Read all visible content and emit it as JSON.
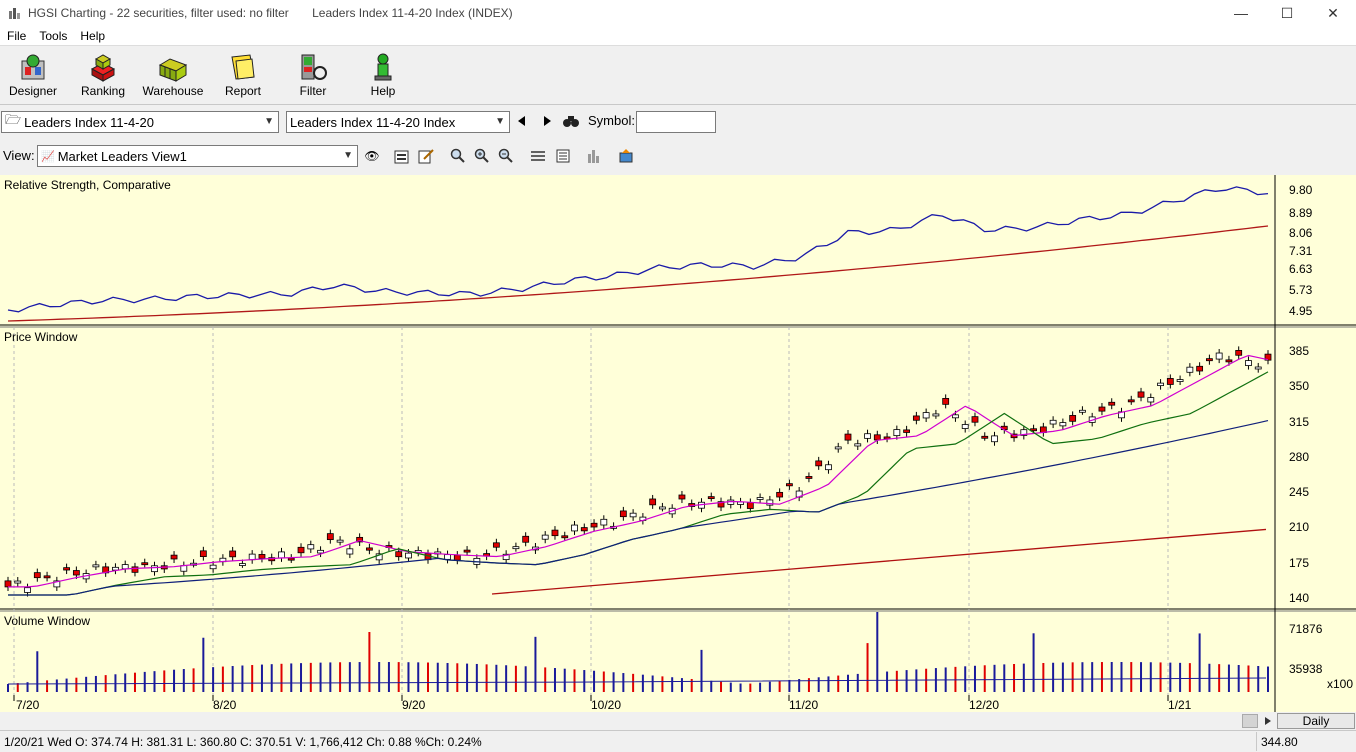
{
  "window": {
    "title": "HGSI Charting - 22 securities, filter used: no filter       Leaders Index 11-4-20 Index (INDEX)",
    "minimize": "—",
    "maximize": "☐",
    "close": "✕"
  },
  "menu": [
    "File",
    "Tools",
    "Help"
  ],
  "toolbar": {
    "buttons": [
      {
        "label": "Designer",
        "icon": "designer-icon"
      },
      {
        "label": "Ranking",
        "icon": "ranking-icon"
      },
      {
        "label": "Warehouse",
        "icon": "warehouse-icon"
      },
      {
        "label": "Report",
        "icon": "report-icon"
      },
      {
        "label": "Filter",
        "icon": "filter-icon"
      },
      {
        "label": "Help",
        "icon": "help-icon"
      }
    ]
  },
  "selectors": {
    "folder_value": "Leaders Index 11-4-20",
    "security_value": "Leaders Index 11-4-20 Index",
    "symbol_label": "Symbol:",
    "symbol_value": ""
  },
  "view": {
    "label": "View:",
    "value": "Market Leaders View1"
  },
  "panels": {
    "rs_title": "Relative Strength, Comparative",
    "price_title": "Price Window",
    "volume_title": "Volume Window"
  },
  "axes": {
    "rs_ticks": [
      "9.80",
      "8.89",
      "8.06",
      "7.31",
      "6.63",
      "5.73",
      "4.95"
    ],
    "price_ticks": [
      "385",
      "350",
      "315",
      "280",
      "245",
      "210",
      "175",
      "140"
    ],
    "volume_ticks": [
      "71876",
      "35938"
    ],
    "volume_multiplier": "x100",
    "date_ticks": [
      "7/20",
      "8/20",
      "9/20",
      "10/20",
      "11/20",
      "12/20",
      "1/21"
    ]
  },
  "periodicity": "Daily",
  "status": {
    "info": "1/20/21 Wed O: 374.74 H: 381.31 L: 360.80 C: 370.51 V: 1,766,412 Ch: 0.88 %Ch: 0.24%",
    "value": "344.80"
  },
  "chart_data": {
    "type": "line",
    "price_range": [
      140,
      385
    ],
    "note": "",
    "series": [
      {
        "name": "",
        "values": [
          150,
          160,
          168,
          170,
          175,
          178,
          180,
          196,
          185,
          182,
          180,
          190,
          205,
          215,
          230,
          235,
          232,
          250,
          295,
          300,
          330,
          300,
          305,
          320,
          330,
          355,
          380,
          370
        ]
      }
    ]
  }
}
